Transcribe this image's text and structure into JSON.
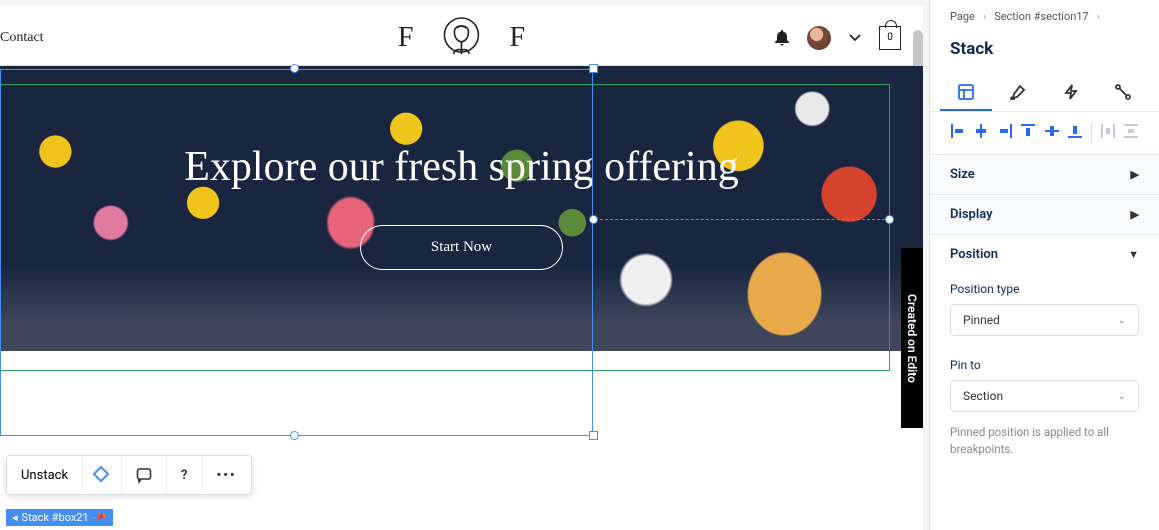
{
  "breadcrumbs": {
    "root": "Page",
    "section": "Section #section17"
  },
  "panel": {
    "title": "Stack"
  },
  "sections": {
    "size": "Size",
    "display": "Display",
    "position": "Position"
  },
  "fields": {
    "position_type": {
      "label": "Position type",
      "value": "Pinned"
    },
    "pin_to": {
      "label": "Pin to",
      "value": "Section"
    },
    "info": "Pinned position is applied to all breakpoints."
  },
  "site": {
    "nav": {
      "contact": "Contact"
    },
    "logo": {
      "left": "F",
      "right": "F"
    },
    "cart_badge": "0",
    "hero": {
      "heading": "Explore our fresh spring offering",
      "cta": "Start Now"
    }
  },
  "toolbar": {
    "unstack": "Unstack"
  },
  "element_tag": {
    "icon": "◂",
    "label": "Stack #box21"
  },
  "side_badge": "Created on Edito"
}
